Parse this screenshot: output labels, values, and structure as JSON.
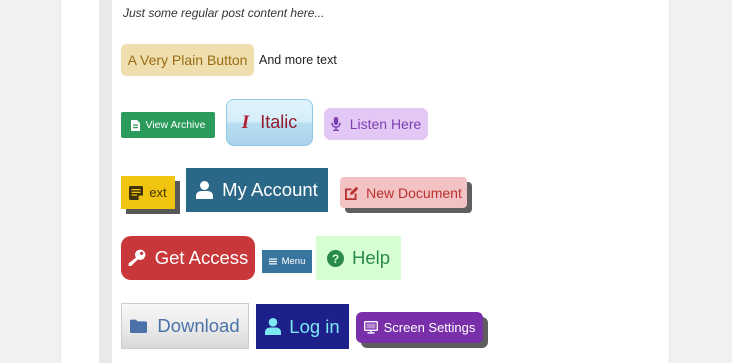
{
  "post": {
    "intro": "Just some regular post content here...",
    "inline_text": "And more text"
  },
  "buttons": {
    "plain": {
      "label": "A Very Plain Button"
    },
    "archive": {
      "label": "View Archive",
      "icon": "archive-icon"
    },
    "italic": {
      "label": "Italic",
      "icon": "italic-icon",
      "icon_glyph": "I"
    },
    "listen": {
      "label": "Listen Here",
      "icon": "microphone-icon"
    },
    "text": {
      "label": "ext",
      "icon": "text-document-icon"
    },
    "account": {
      "label": "My Account",
      "icon": "user-icon"
    },
    "new_document": {
      "label": "New Document",
      "icon": "edit-icon"
    },
    "access": {
      "label": "Get Access",
      "icon": "key-icon"
    },
    "menu": {
      "label": "Menu",
      "icon": "menu-icon"
    },
    "help": {
      "label": "Help",
      "icon": "question-icon"
    },
    "download": {
      "label": "Download",
      "icon": "folder-icon"
    },
    "login": {
      "label": "Log in",
      "icon": "user-icon"
    },
    "screen_settings": {
      "label": "Screen Settings",
      "icon": "monitor-icon"
    }
  },
  "colors": {
    "page_background": "#f1f1f1",
    "panel_background": "#ffffff",
    "plain_button": "#f0dfae",
    "archive_button": "#2b9b5c",
    "italic_button": "#c8e7f7",
    "listen_button": "#e3c8f6",
    "text_button": "#f1c40f",
    "account_button": "#2b6888",
    "new_document_button": "#f3c3c3",
    "access_button": "#c8373a",
    "menu_button": "#39749e",
    "help_button": "#d7ffd4",
    "download_button": "#e8e8e8",
    "login_button": "#1d1f8b",
    "screen_settings_button": "#7a2faa"
  }
}
